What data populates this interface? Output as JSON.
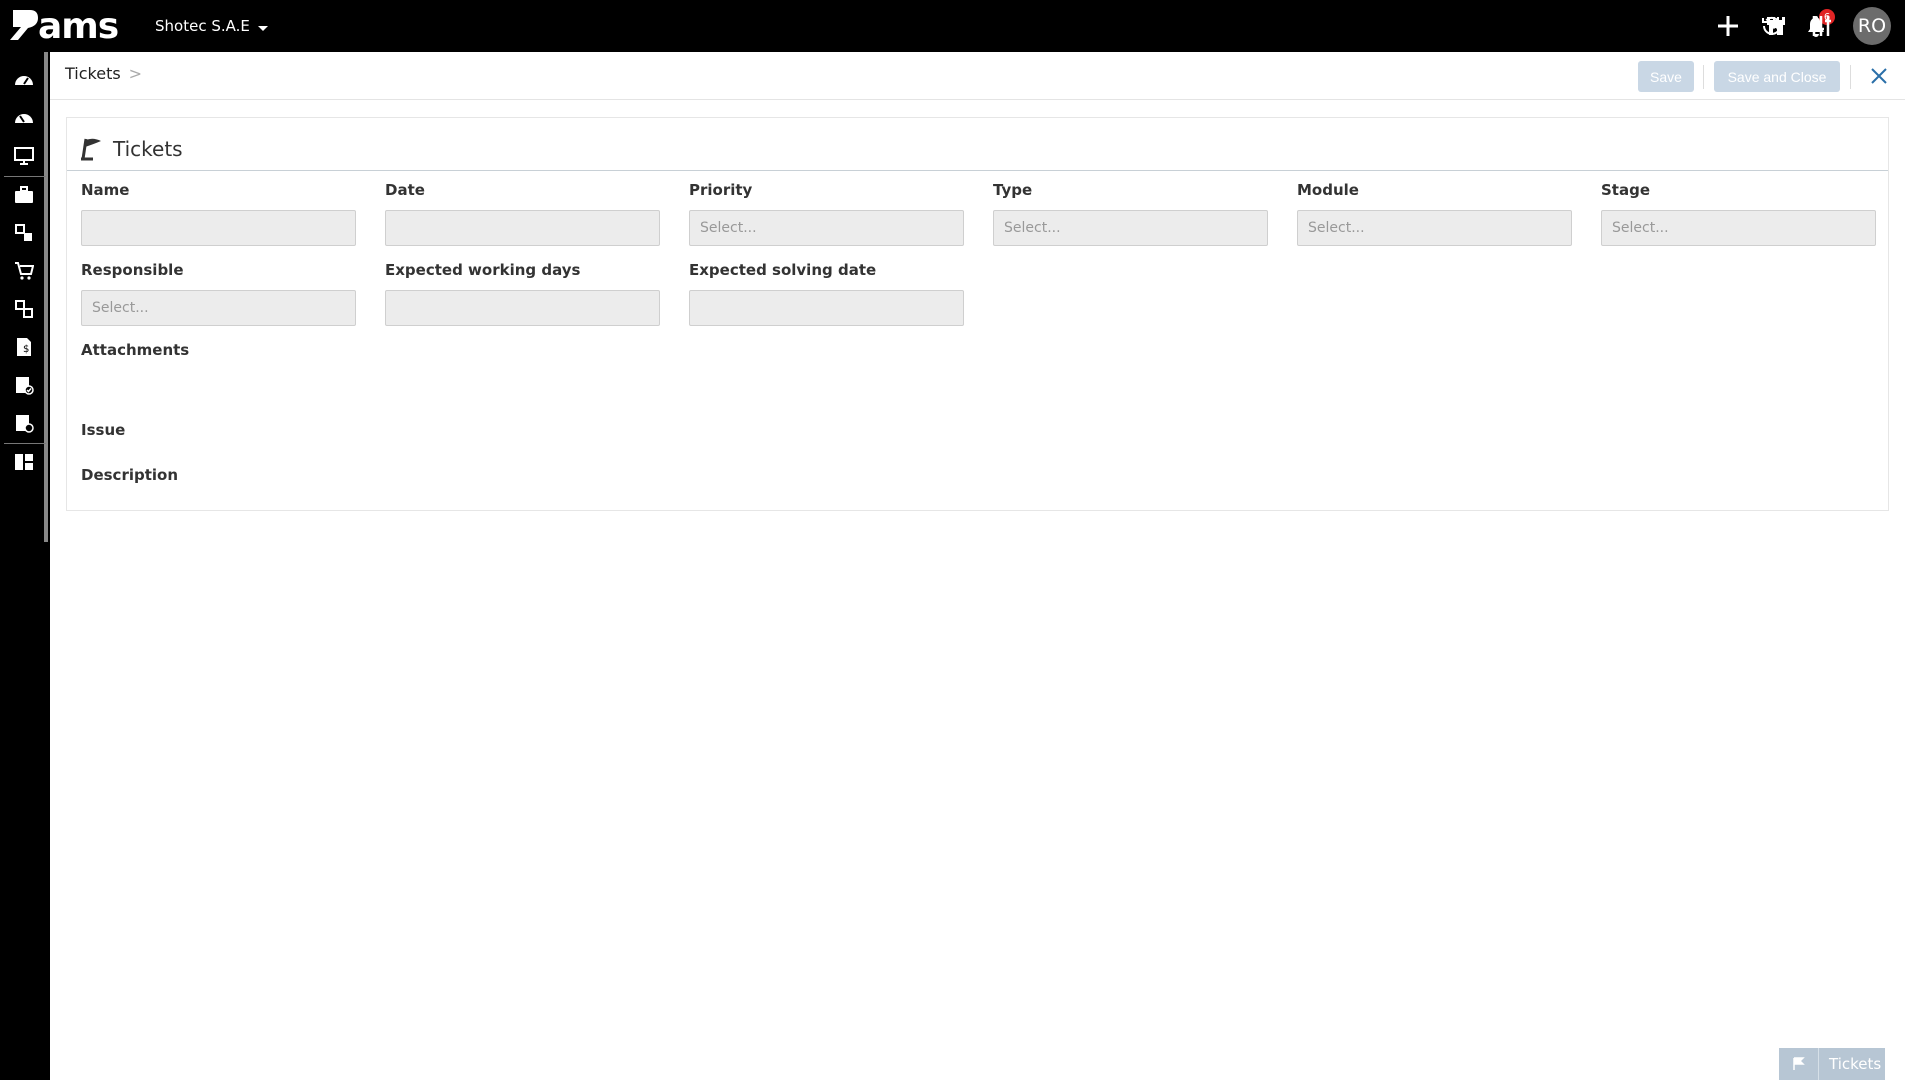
{
  "app": {
    "logo_text": "ams",
    "company": "Shotec S.A.E",
    "notification_count": "6",
    "user_initials": "RO"
  },
  "breadcrumb": {
    "current": "Tickets",
    "separator": ">"
  },
  "toolbar": {
    "save_label": "Save",
    "save_close_label": "Save and Close"
  },
  "card": {
    "title": "Tickets",
    "fields_row1": [
      {
        "label": "Name",
        "placeholder": ""
      },
      {
        "label": "Date",
        "placeholder": ""
      },
      {
        "label": "Priority",
        "placeholder": "Select..."
      },
      {
        "label": "Type",
        "placeholder": "Select..."
      },
      {
        "label": "Module",
        "placeholder": "Select..."
      },
      {
        "label": "Stage",
        "placeholder": "Select..."
      }
    ],
    "fields_row2": [
      {
        "label": "Responsible",
        "placeholder": "Select..."
      },
      {
        "label": "Expected working days",
        "placeholder": ""
      },
      {
        "label": "Expected solving date",
        "placeholder": ""
      }
    ],
    "attachments_label": "Attachments",
    "issue_label": "Issue",
    "description_label": "Description"
  },
  "bottom_tab": {
    "label": "Tickets",
    "icon": "flag-icon"
  },
  "sidebar": {
    "items": [
      {
        "icon": "dashboard-icon"
      },
      {
        "icon": "dashboard-alt-icon"
      },
      {
        "icon": "monitor-icon"
      },
      {
        "icon": "briefcase-icon"
      },
      {
        "icon": "stock-icon"
      },
      {
        "icon": "cart-icon"
      },
      {
        "icon": "inventory-icon"
      },
      {
        "icon": "invoice-icon"
      },
      {
        "icon": "approved-doc-icon"
      },
      {
        "icon": "settings-doc-icon"
      },
      {
        "icon": "apps-icon"
      }
    ]
  },
  "colors": {
    "topbar": "#000000",
    "button_disabled": "#c9d7e5",
    "badge": "#e02424",
    "close": "#2a6fa8"
  }
}
